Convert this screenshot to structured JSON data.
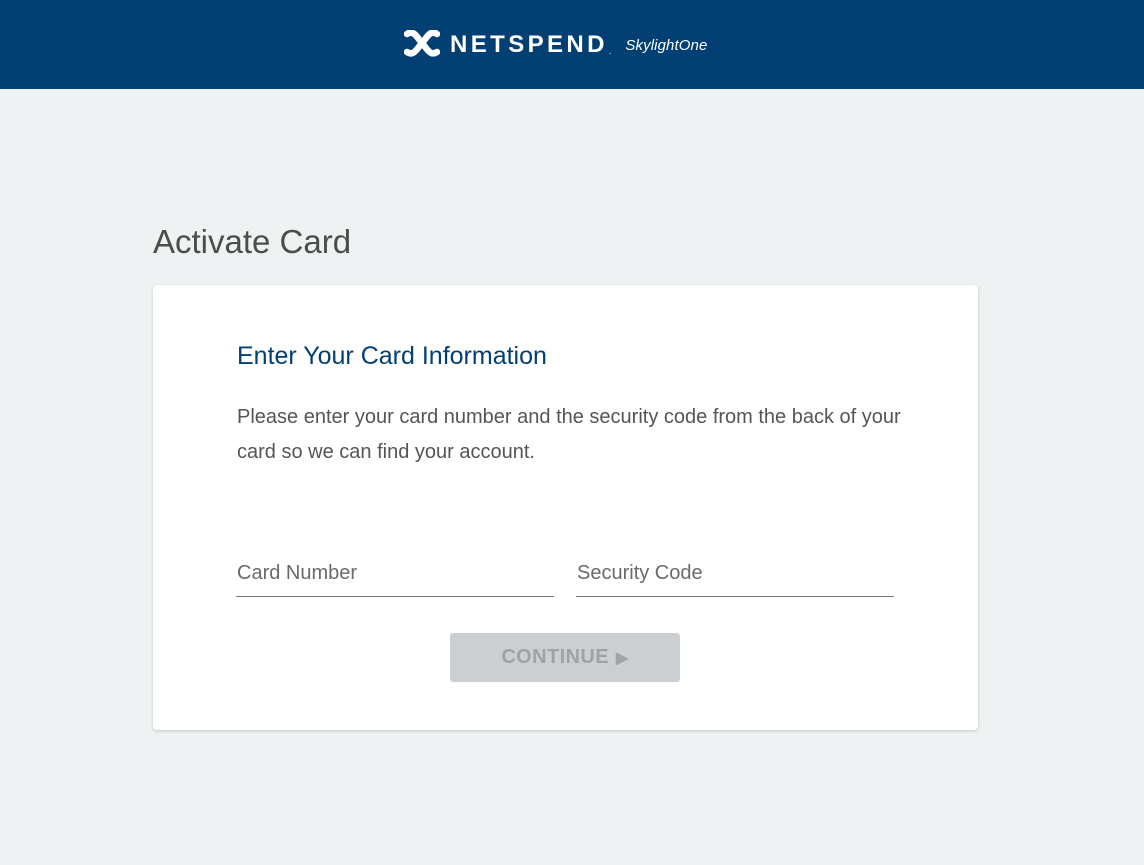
{
  "header": {
    "brand_name": "NETSPEND",
    "brand_reg": ".",
    "brand_sub": "SkylightOne",
    "background_color": "#023f73"
  },
  "page": {
    "title": "Activate Card"
  },
  "card": {
    "heading": "Enter Your Card Information",
    "description": "Please enter your card number and the security code from the back of your card so we can find your account.",
    "card_number_placeholder": "Card Number",
    "security_code_placeholder": "Security Code",
    "continue_label": "CONTINUE",
    "continue_icon": "play-arrow-icon"
  }
}
